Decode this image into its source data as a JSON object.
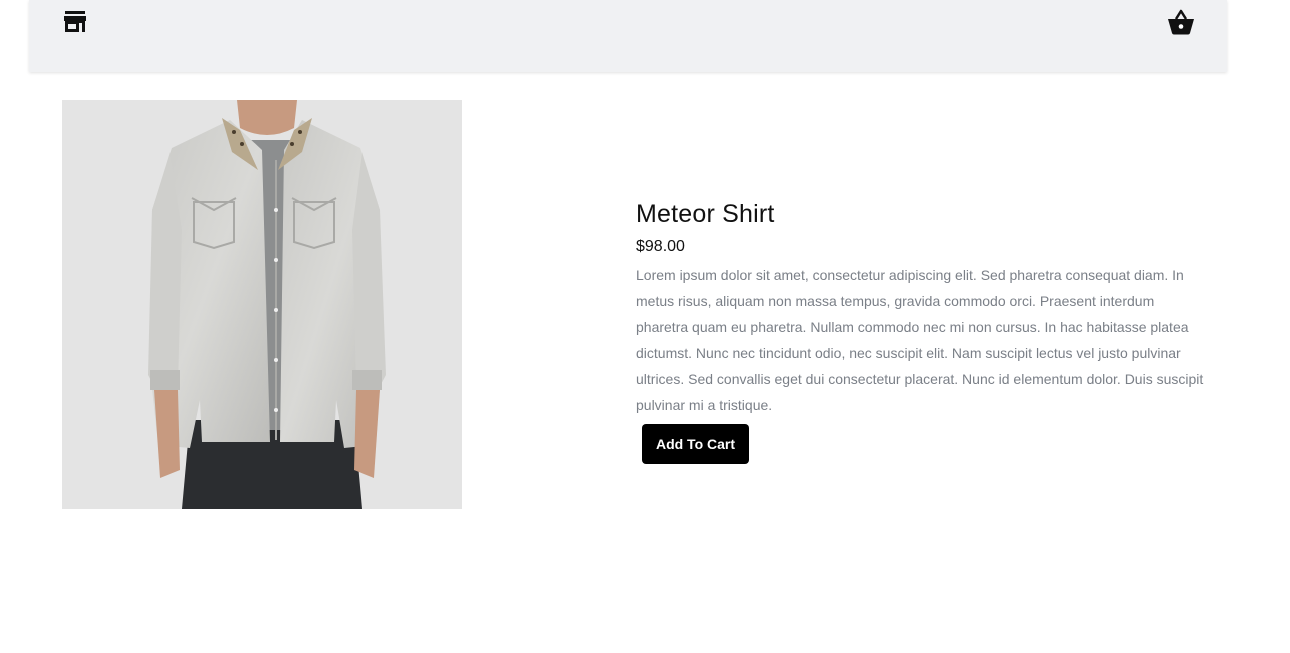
{
  "navbar": {
    "store_icon": "store-icon",
    "cart_icon": "shopping-basket-icon",
    "background": "#f0f1f3"
  },
  "product": {
    "title": "Meteor Shirt",
    "price": "$98.00",
    "description": "Lorem ipsum dolor sit amet, consectetur adipiscing elit. Sed pharetra consequat diam. In metus risus, aliquam non massa tempus, gravida commodo orci. Praesent interdum pharetra quam eu pharetra. Nullam commodo nec mi non cursus. In hac habitasse platea dictumst. Nunc nec tincidunt odio, nec suscipit elit. Nam suscipit lectus vel justo pulvinar ultrices. Sed convallis eget dui consectetur placerat. Nunc id elementum dolor. Duis suscipit pulvinar mi a tristique.",
    "add_to_cart_label": "Add To Cart",
    "button_color": "#000000",
    "description_color": "#7a7f87"
  }
}
